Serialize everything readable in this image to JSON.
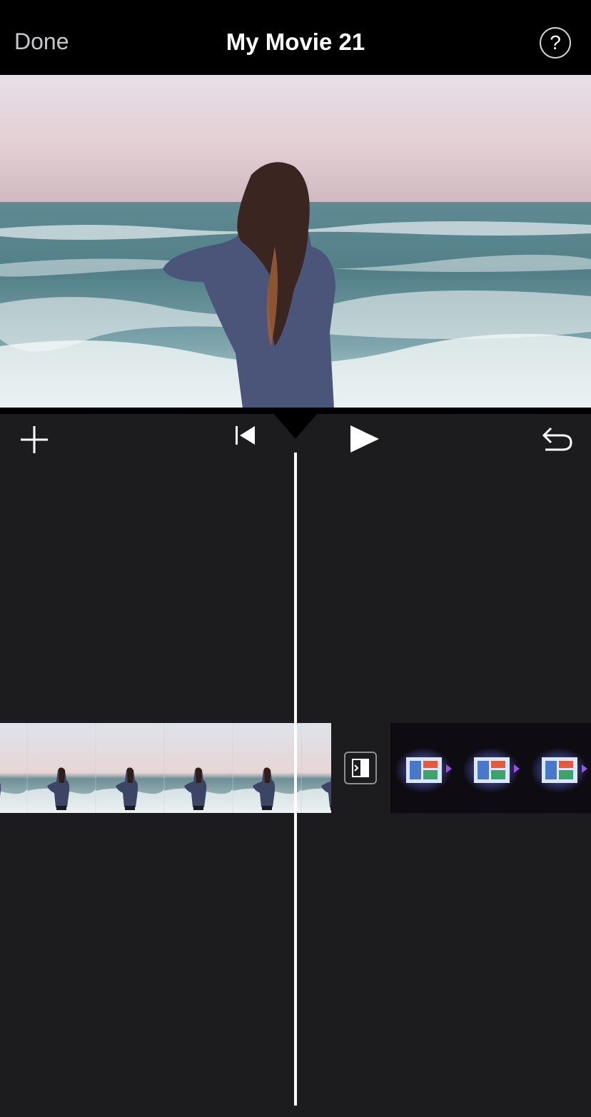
{
  "topbar": {
    "done_label": "Done",
    "title": "My Movie 21",
    "help_label": "?"
  },
  "controls": {
    "add_icon": "plus-icon",
    "rewind_icon": "skip-to-start-icon",
    "play_icon": "play-icon",
    "undo_icon": "undo-icon"
  },
  "timeline": {
    "transition_icon": "transition-icon"
  },
  "colors": {
    "background": "#1c1c1e",
    "bar": "#000000",
    "text_primary": "#ffffff",
    "text_secondary": "#c7c7cc",
    "playhead": "#ffffff"
  }
}
